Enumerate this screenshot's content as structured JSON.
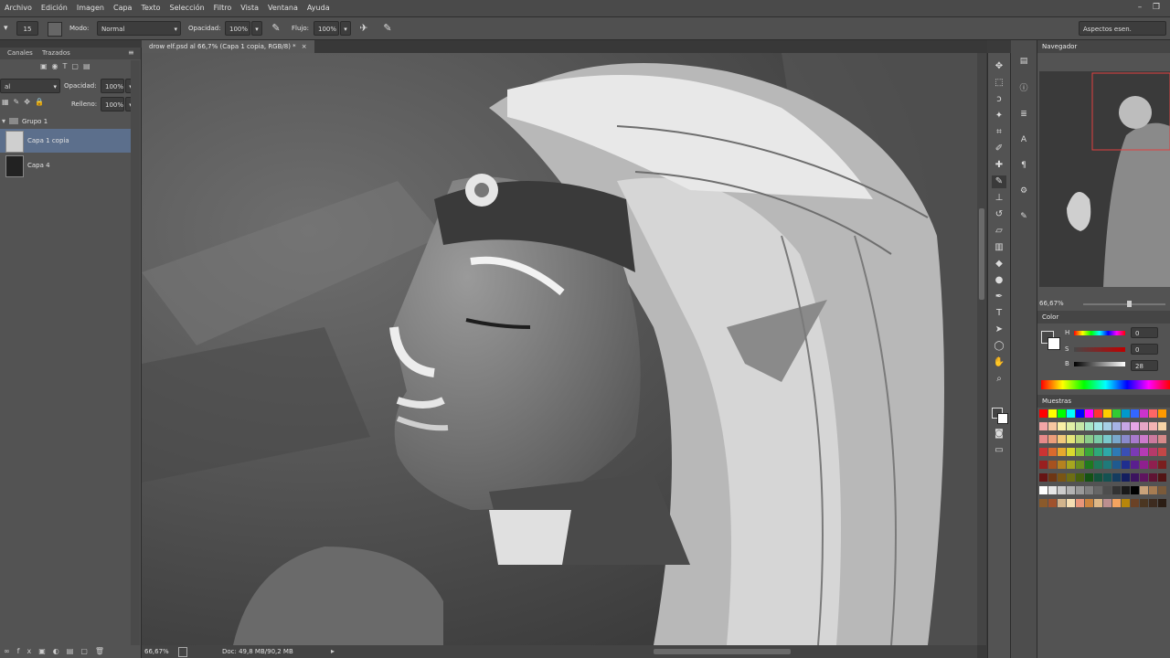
{
  "menu": [
    "Archivo",
    "Edición",
    "Imagen",
    "Capa",
    "Texto",
    "Selección",
    "Filtro",
    "Vista",
    "Ventana",
    "Ayuda"
  ],
  "options": {
    "brush_size": "15",
    "mode_label": "Modo:",
    "mode_value": "Normal",
    "opacity_label": "Opacidad:",
    "opacity_value": "100%",
    "flow_label": "Flujo:",
    "flow_value": "100%",
    "workspace": "Aspectos esen."
  },
  "document_tab": "drow elf.psd al 66,7% (Capa 1 copia, RGB/8) *",
  "layers_panel": {
    "tabs": [
      "Canales",
      "Trazados"
    ],
    "blend_mode": "al",
    "opacity_label": "Opacidad:",
    "opacity_value": "100%",
    "fill_label": "Relleno:",
    "fill_value": "100%",
    "group": "Grupo 1",
    "layers": [
      "Capa 1 copia",
      "Capa 4"
    ]
  },
  "navigator": {
    "title": "Navegador",
    "zoom": "66,67%"
  },
  "color_panel": {
    "title": "Color",
    "h_label": "H",
    "h_value": "0",
    "s_label": "S",
    "s_value": "0",
    "b_label": "B",
    "b_value": "28"
  },
  "swatches": {
    "title": "Muestras",
    "colors": [
      "#ff0000",
      "#ffff00",
      "#00ff00",
      "#00ffff",
      "#0000ff",
      "#ff00ff",
      "#ff3333",
      "#ffcc00",
      "#33cc33",
      "#0099cc",
      "#3366ff",
      "#cc33cc",
      "#ff6666",
      "#ff9900",
      "#f4a6a6",
      "#f7c7a0",
      "#faf0a6",
      "#e1f0a6",
      "#c6e6a6",
      "#a6e6c6",
      "#a6e6e6",
      "#a6cfe6",
      "#a6b3e6",
      "#c6a6e6",
      "#e6a6e6",
      "#e6a6c6",
      "#f4b3b3",
      "#f7d3a6",
      "#e68a8a",
      "#ec9e7a",
      "#f2c97a",
      "#e6e67a",
      "#b5d67a",
      "#8acc8a",
      "#7acca8",
      "#7ac9cc",
      "#7aa8cc",
      "#8a8acc",
      "#a87acc",
      "#cc7acc",
      "#cc7a9e",
      "#d68a8a",
      "#cc3333",
      "#d96a2e",
      "#e6a82e",
      "#d9d92e",
      "#8fc23a",
      "#3aa83a",
      "#2ea87a",
      "#2ea8a8",
      "#2e7ab5",
      "#3a4fb5",
      "#7a3ab5",
      "#b53ab5",
      "#b53a6a",
      "#c24747",
      "#991f1f",
      "#a6521f",
      "#b5821f",
      "#a6a61f",
      "#6a8f1f",
      "#1f7a1f",
      "#1f7a5a",
      "#1f7a7a",
      "#1f5a8f",
      "#1f2e8f",
      "#5a1f8f",
      "#8f1f8f",
      "#8f1f4f",
      "#7a1f1f",
      "#661414",
      "#6e3614",
      "#7a5514",
      "#6e6e14",
      "#46600f",
      "#145214",
      "#14523c",
      "#145252",
      "#143c5f",
      "#141e5f",
      "#3c145f",
      "#5f145f",
      "#5f1434",
      "#521414",
      "#ffffff",
      "#e6e6e6",
      "#cccccc",
      "#b3b3b3",
      "#999999",
      "#808080",
      "#666666",
      "#4d4d4d",
      "#333333",
      "#1a1a1a",
      "#000000",
      "#c9a27a",
      "#a67c52",
      "#7a5a3a",
      "#8b5a2b",
      "#a0522d",
      "#d2b48c",
      "#f5deb3",
      "#e9967a",
      "#cd853f",
      "#deb887",
      "#bc8f8f",
      "#f4a460",
      "#b8860b",
      "#6b4226",
      "#4b3621",
      "#3d2b1f",
      "#2b1d14"
    ]
  },
  "status": {
    "zoom": "66,67%",
    "doc": "Doc: 49,8 MB/90,2 MB"
  },
  "colors": {
    "accent_layer": "#5c6f8c",
    "ui_dark": "#3a3a3a"
  }
}
